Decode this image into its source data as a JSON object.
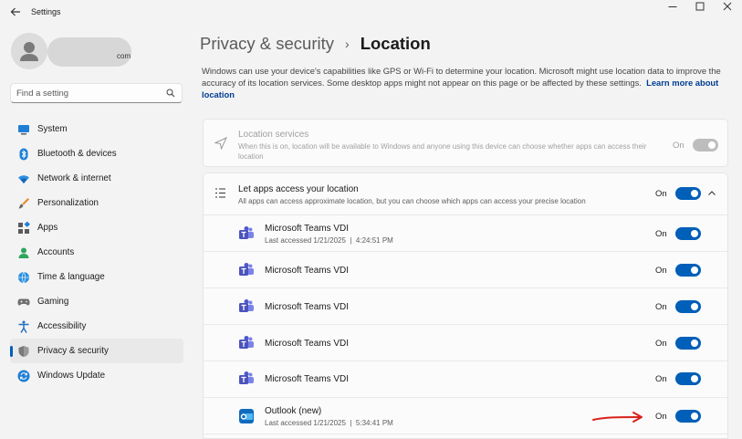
{
  "window": {
    "title": "Settings"
  },
  "profile": {
    "email_suffix": "com"
  },
  "search": {
    "placeholder": "Find a setting"
  },
  "sidebar": {
    "items": [
      {
        "label": "System",
        "icon": "monitor-icon"
      },
      {
        "label": "Bluetooth & devices",
        "icon": "bluetooth-icon"
      },
      {
        "label": "Network & internet",
        "icon": "wifi-icon"
      },
      {
        "label": "Personalization",
        "icon": "brush-icon"
      },
      {
        "label": "Apps",
        "icon": "apps-icon"
      },
      {
        "label": "Accounts",
        "icon": "person-icon"
      },
      {
        "label": "Time & language",
        "icon": "globe-clock-icon"
      },
      {
        "label": "Gaming",
        "icon": "gamepad-icon"
      },
      {
        "label": "Accessibility",
        "icon": "accessibility-icon"
      },
      {
        "label": "Privacy & security",
        "icon": "shield-icon",
        "active": true
      },
      {
        "label": "Windows Update",
        "icon": "update-icon"
      }
    ]
  },
  "header": {
    "parent": "Privacy & security",
    "separator": "›",
    "current": "Location"
  },
  "description": {
    "text": "Windows can use your device's capabilities like GPS or Wi-Fi to determine your location. Microsoft might use location data to improve the accuracy of its location services. Some desktop apps might not appear on this page or be affected by these settings.",
    "link": "Learn more about location"
  },
  "location_services": {
    "title": "Location services",
    "subtitle": "When this is on, location will be available to Windows and anyone using this device can choose whether apps can access their location",
    "state": "On"
  },
  "apps_access": {
    "title": "Let apps access your location",
    "subtitle": "All apps can access approximate location, but you can choose which apps can access your precise location",
    "state": "On"
  },
  "apps": [
    {
      "name": "Microsoft Teams VDI",
      "detail": "Last accessed 1/21/2025  |  4:24:51 PM",
      "state": "On",
      "icon": "teams-icon"
    },
    {
      "name": "Microsoft Teams VDI",
      "detail": "",
      "state": "On",
      "icon": "teams-icon"
    },
    {
      "name": "Microsoft Teams VDI",
      "detail": "",
      "state": "On",
      "icon": "teams-icon"
    },
    {
      "name": "Microsoft Teams VDI",
      "detail": "",
      "state": "On",
      "icon": "teams-icon"
    },
    {
      "name": "Microsoft Teams VDI",
      "detail": "",
      "state": "On",
      "icon": "teams-icon"
    },
    {
      "name": "Outlook (new)",
      "detail": "Last accessed 1/21/2025  |  5:34:41 PM",
      "state": "On",
      "icon": "outlook-icon"
    }
  ],
  "colors": {
    "accent": "#005fb8",
    "annotation_arrow": "#d9211c"
  }
}
